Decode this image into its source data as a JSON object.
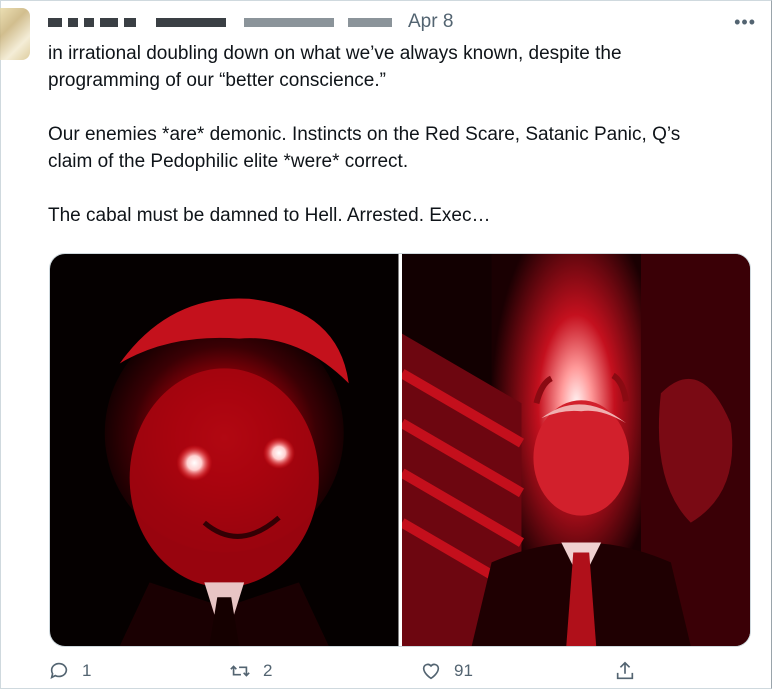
{
  "tweet": {
    "date": "Apr 8",
    "more_label": "•••",
    "text": "in irrational doubling down on what we’ve always known, despite the\nprogramming of our “better conscience.”\n\nOur enemies *are* demonic. Instincts on the Red Scare, Satanic Panic, Q’s\nclaim of the Pedophilic elite *were* correct.\n\nThe cabal must be damned to Hell. Arrested. Exec…"
  },
  "actions": {
    "reply_count": "1",
    "retweet_count": "2",
    "like_count": "91"
  },
  "icons": {
    "reply": "reply-icon",
    "retweet": "retweet-icon",
    "like": "heart-icon",
    "share": "share-icon",
    "more": "more-icon"
  },
  "colors": {
    "muted_text": "#536471",
    "image_red": "#c8102e"
  }
}
